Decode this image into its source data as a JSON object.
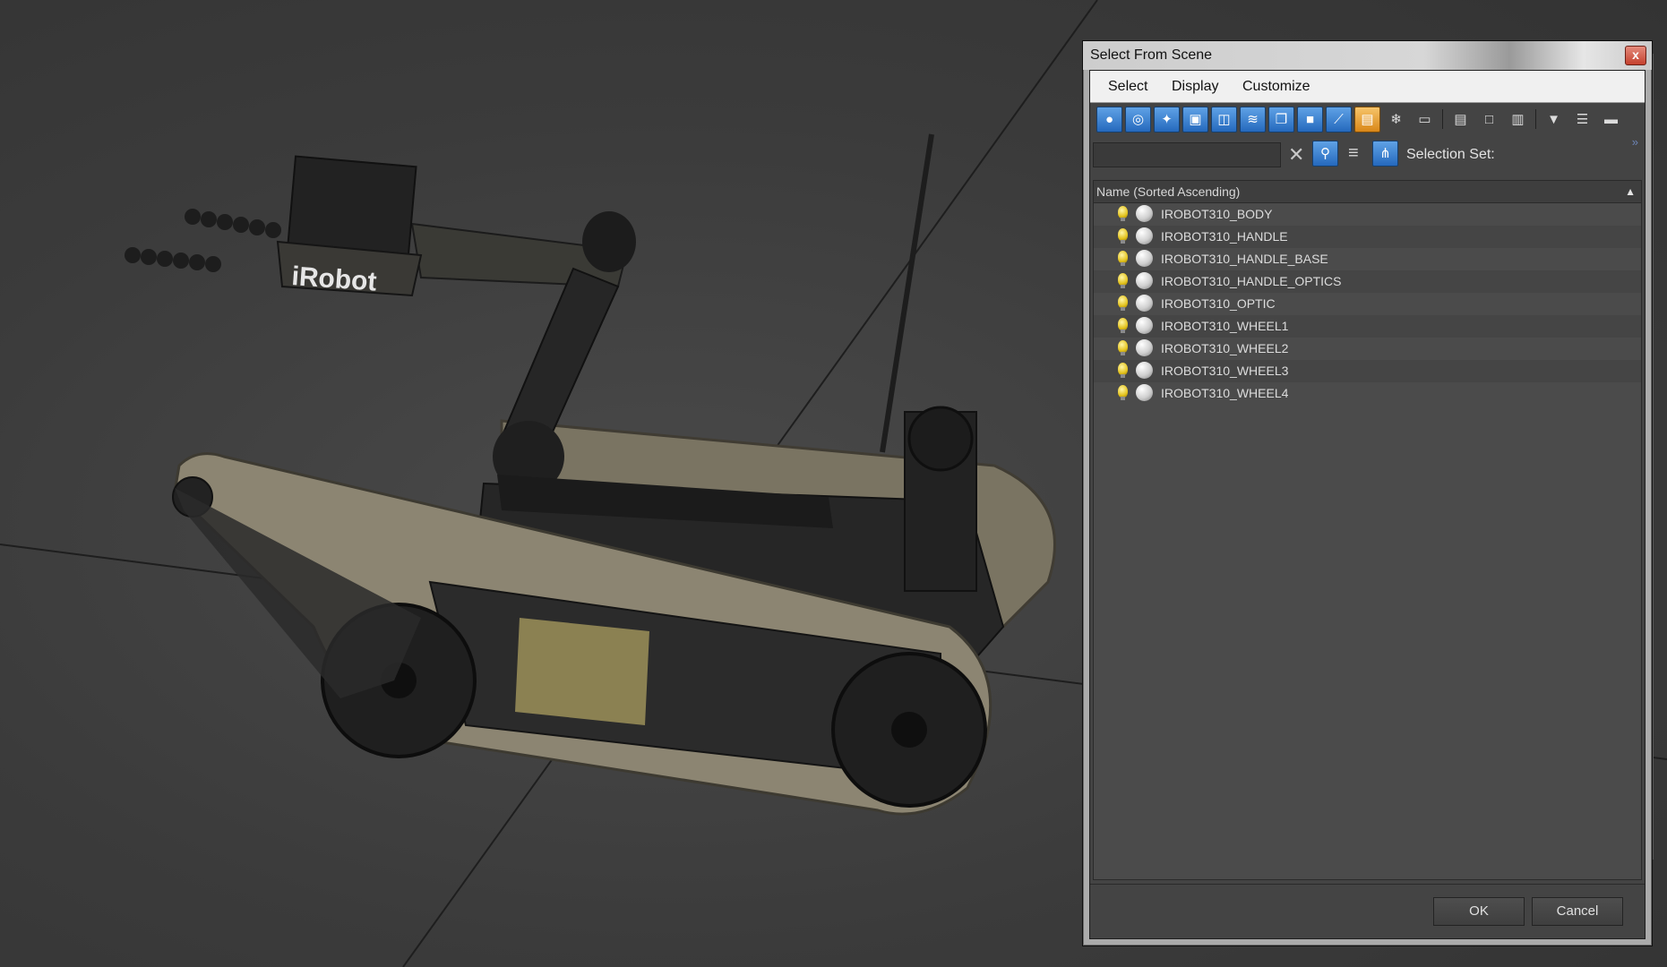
{
  "dialog": {
    "title": "Select From Scene",
    "close_glyph": "x"
  },
  "menu": {
    "select": "Select",
    "display": "Display",
    "customize": "Customize"
  },
  "toolbar_icons": [
    "display-geometry-icon",
    "display-shapes-icon",
    "display-lights-icon",
    "display-cameras-icon",
    "display-helpers-icon",
    "display-spacewarps-icon",
    "display-groups-icon",
    "display-xrefs-icon",
    "display-bones-icon",
    "display-containers-icon",
    "display-frozen-icon",
    "display-hidden-icon",
    "select-all-icon",
    "select-none-icon",
    "select-invert-icon",
    "filter-icon",
    "filter-options-icon",
    "collapse-icon"
  ],
  "search": {
    "value": "",
    "placeholder": "",
    "selection_set_label": "Selection Set:",
    "more_glyph": "»"
  },
  "list": {
    "header": "Name (Sorted Ascending)",
    "sort_glyph": "▲",
    "items": [
      "IROBOT310_BODY",
      "IROBOT310_HANDLE",
      "IROBOT310_HANDLE_BASE",
      "IROBOT310_HANDLE_OPTICS",
      "IROBOT310_OPTIC",
      "IROBOT310_WHEEL1",
      "IROBOT310_WHEEL2",
      "IROBOT310_WHEEL3",
      "IROBOT310_WHEEL4"
    ]
  },
  "buttons": {
    "ok": "OK",
    "cancel": "Cancel"
  },
  "viewport": {
    "logo_text": "iRobot"
  },
  "colors": {
    "viewport_bg": "#3b3b3b",
    "track": "#8c8572",
    "body": "#232323",
    "accent_blue": "#2a6fc4"
  }
}
